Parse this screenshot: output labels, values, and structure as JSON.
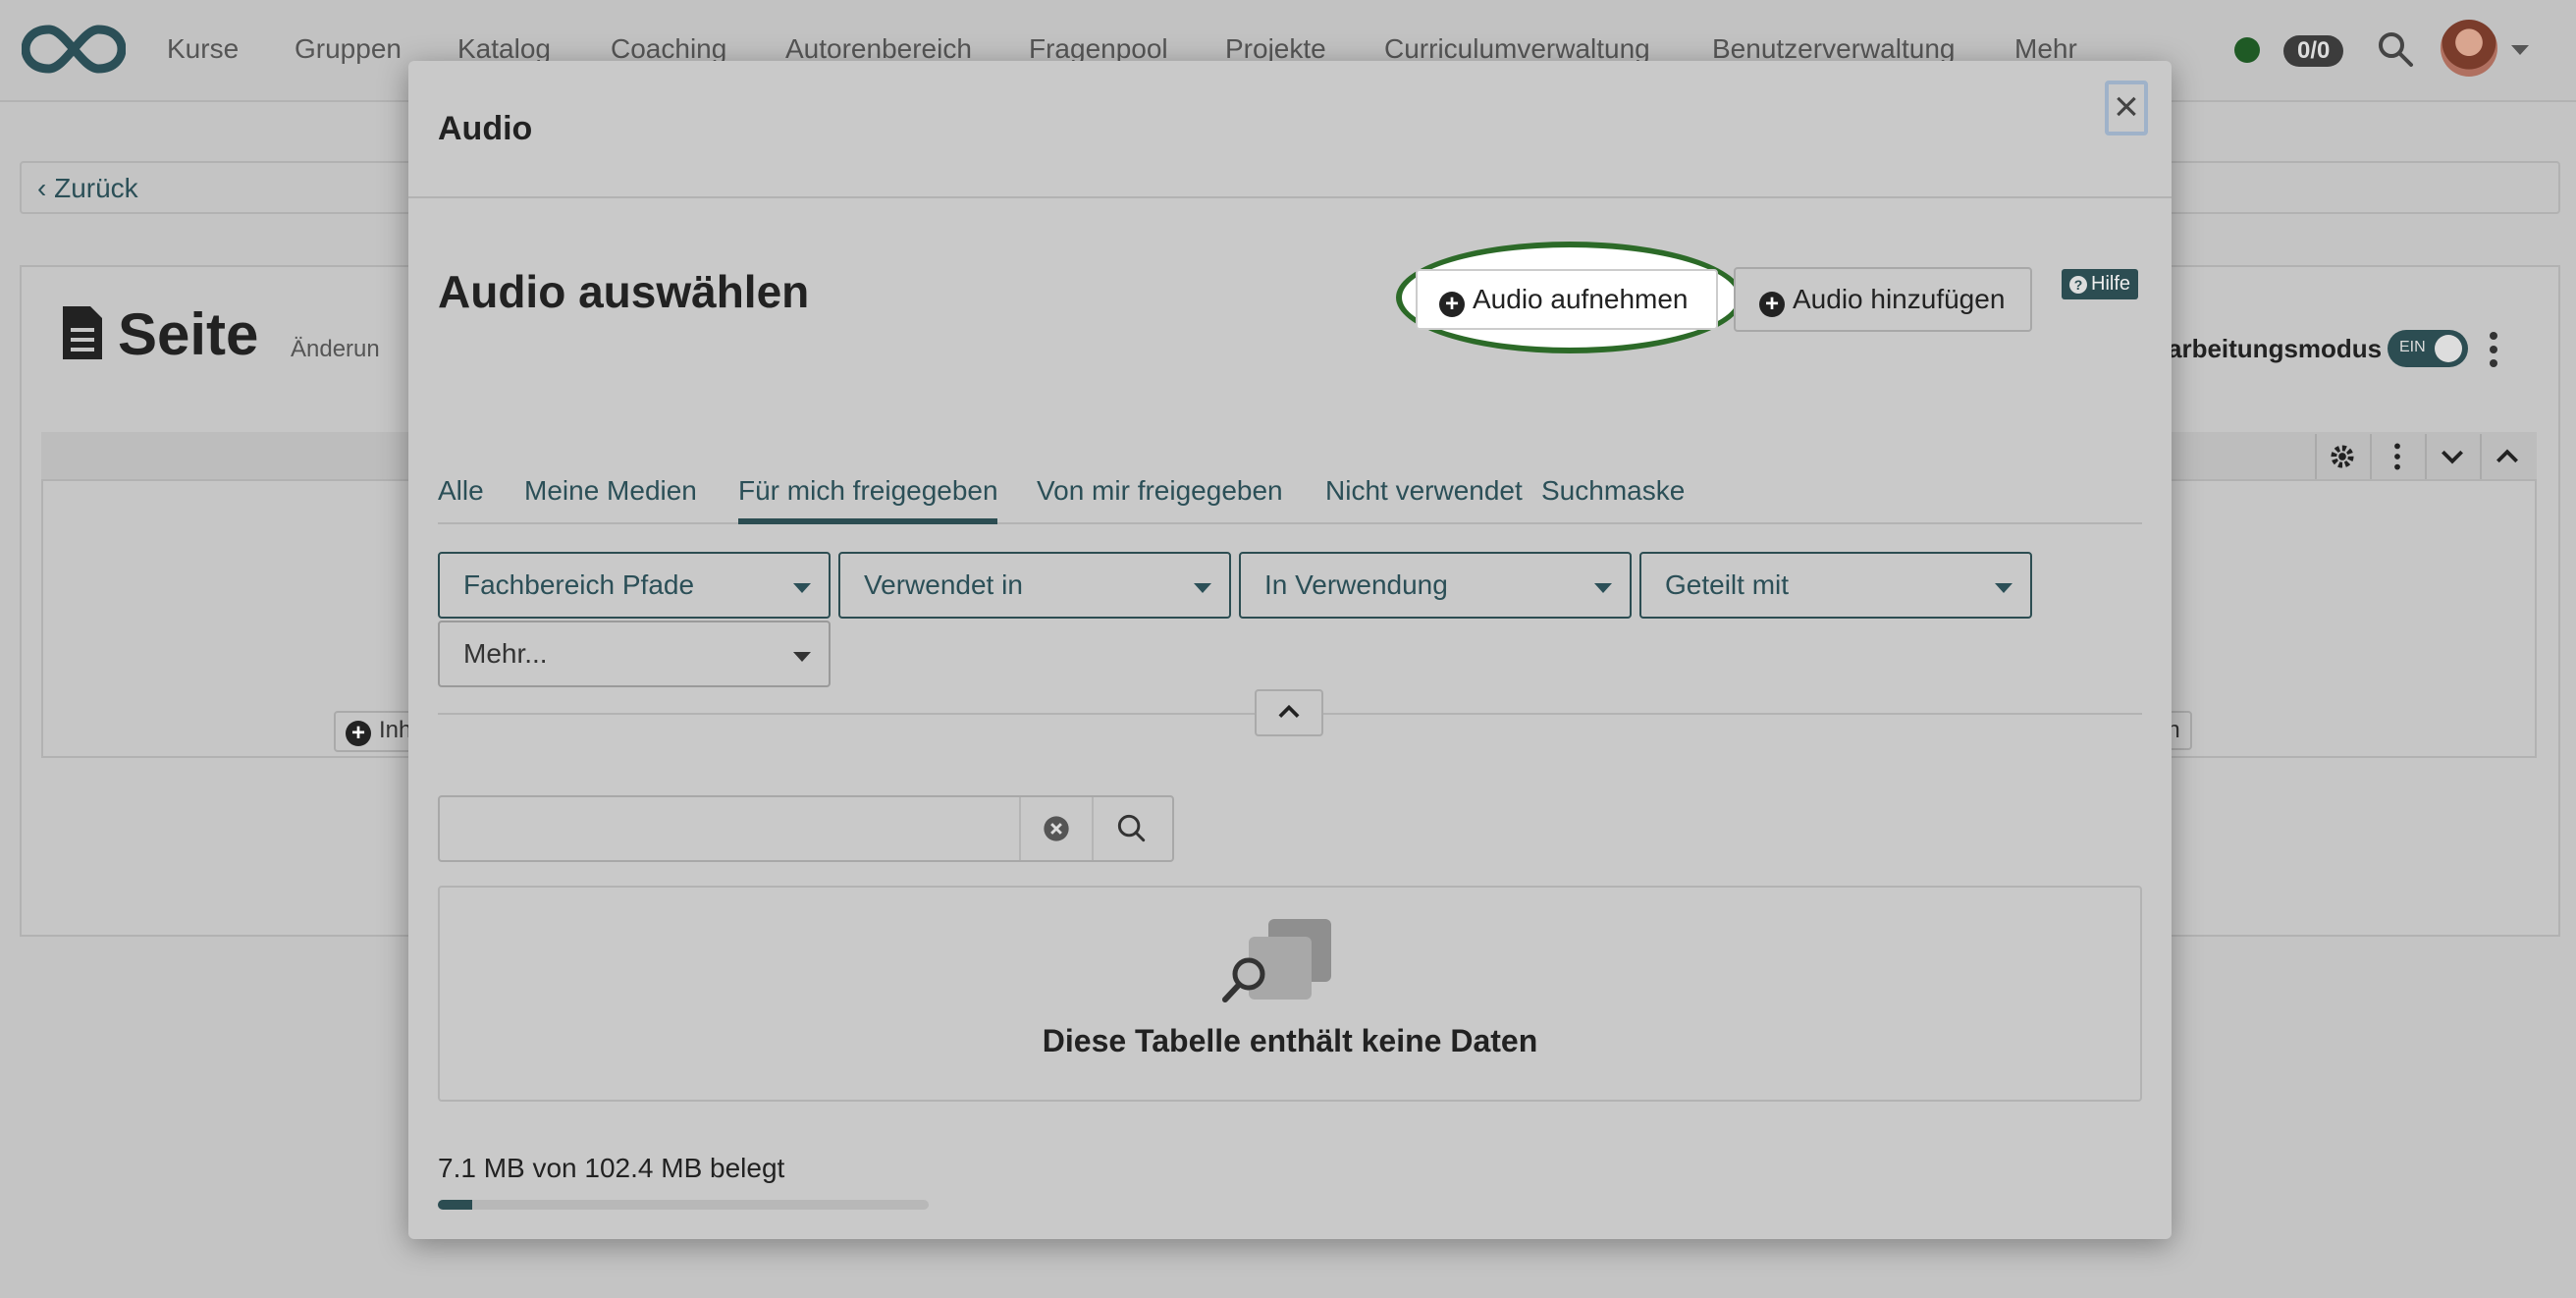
{
  "nav": {
    "items": [
      "Kurse",
      "Gruppen",
      "Katalog",
      "Coaching",
      "Autorenbereich",
      "Fragenpool",
      "Projekte",
      "Curriculumverwaltung",
      "Benutzerverwaltung",
      "Mehr"
    ],
    "status_count": "0/0"
  },
  "background": {
    "back_label": "Zurück",
    "page_title": "Seite",
    "save_hint": "Änderun",
    "edit_mode_label": "arbeitungsmodus",
    "toggle_label": "EIN",
    "add_left_label": "Inh",
    "add_right_label": "en"
  },
  "modal": {
    "title": "Audio",
    "close_label": "×",
    "section_title": "Audio auswählen",
    "record_button": "Audio aufnehmen",
    "add_button": "Audio hinzufügen",
    "help_button": "Hilfe",
    "tabs": [
      "Alle",
      "Meine Medien",
      "Für mich freigegeben",
      "Von mir freigegeben",
      "Nicht verwendet",
      "Suchmaske"
    ],
    "active_tab": "Für mich freigegeben",
    "filters": [
      "Fachbereich Pfade",
      "Verwendet in",
      "In Verwendung",
      "Geteilt mit",
      "Mehr..."
    ],
    "search": {
      "value": "",
      "placeholder": ""
    },
    "empty_message": "Diese Tabelle enthält keine Daten",
    "storage_text": "7.1 MB von 102.4 MB belegt",
    "storage_fraction": 0.069
  },
  "colors": {
    "accent": "#2c4d52",
    "highlight_ring": "#2c6a28",
    "status_dot": "#1f5a25"
  }
}
